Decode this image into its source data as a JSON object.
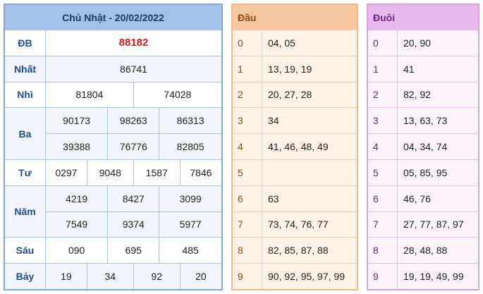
{
  "results": {
    "date_title": "Chủ Nhật - 20/02/2022",
    "rows": {
      "db": {
        "label": "ĐB",
        "values": [
          "88182"
        ]
      },
      "nhat": {
        "label": "Nhất",
        "values": [
          "86741"
        ]
      },
      "nhi": {
        "label": "Nhì",
        "values": [
          "81804",
          "74028"
        ]
      },
      "ba": {
        "label": "Ba",
        "values": [
          "90173",
          "98263",
          "86313",
          "39388",
          "76776",
          "82805"
        ]
      },
      "tu": {
        "label": "Tư",
        "values": [
          "0297",
          "9048",
          "1587",
          "7846"
        ]
      },
      "nam": {
        "label": "Năm",
        "values": [
          "4219",
          "8427",
          "3099",
          "7549",
          "9374",
          "5977"
        ]
      },
      "sau": {
        "label": "Sáu",
        "values": [
          "090",
          "695",
          "485"
        ]
      },
      "bay": {
        "label": "Bảy",
        "values": [
          "19",
          "34",
          "92",
          "20"
        ]
      }
    },
    "special_color": "#d0211b"
  },
  "dau": {
    "header": "Đầu",
    "rows": [
      {
        "k": "0",
        "v": "04, 05"
      },
      {
        "k": "1",
        "v": "13, 19, 19"
      },
      {
        "k": "2",
        "v": "20, 27, 28"
      },
      {
        "k": "3",
        "v": "34"
      },
      {
        "k": "4",
        "v": "41, 46, 48, 49"
      },
      {
        "k": "5",
        "v": ""
      },
      {
        "k": "6",
        "v": "63"
      },
      {
        "k": "7",
        "v": "73, 74, 76, 77"
      },
      {
        "k": "8",
        "v": "82, 85, 87, 88"
      },
      {
        "k": "9",
        "v": "90, 92, 95, 97, 99"
      }
    ]
  },
  "duoi": {
    "header": "Đuôi",
    "rows": [
      {
        "k": "0",
        "v": "20, 90"
      },
      {
        "k": "1",
        "v": "41"
      },
      {
        "k": "2",
        "v": "82, 92"
      },
      {
        "k": "3",
        "v": "13, 63, 73"
      },
      {
        "k": "4",
        "v": "04, 34, 74"
      },
      {
        "k": "5",
        "v": "05, 85, 95"
      },
      {
        "k": "6",
        "v": "46, 76"
      },
      {
        "k": "7",
        "v": "27, 77, 87, 97"
      },
      {
        "k": "8",
        "v": "28, 48, 88"
      },
      {
        "k": "9",
        "v": "19, 19, 49, 99"
      }
    ]
  }
}
